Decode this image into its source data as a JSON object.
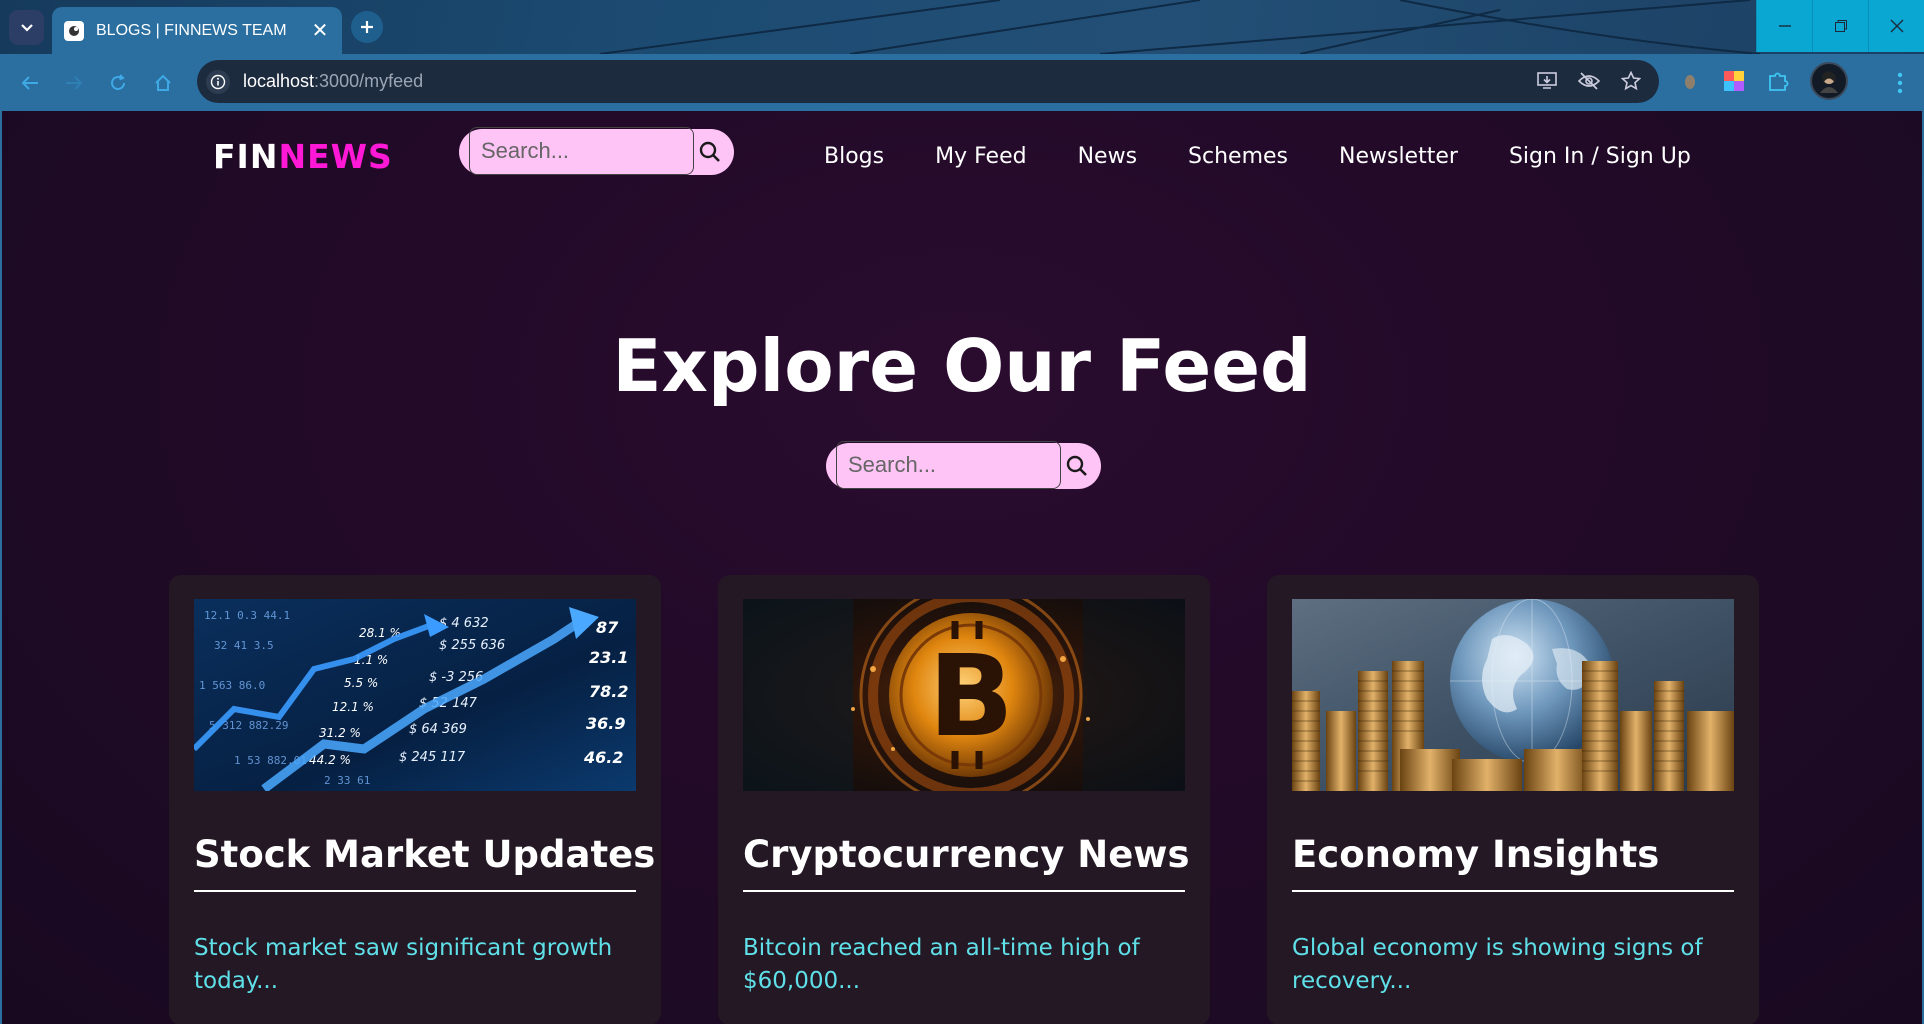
{
  "browser": {
    "tab_title": "BLOGS | FINNEWS TEAM",
    "url_host": "localhost",
    "url_path": ":3000/myfeed"
  },
  "site": {
    "logo_part1": "FIN",
    "logo_part2": "NEWS",
    "header_search_placeholder": "Search...",
    "nav": [
      "Blogs",
      "My Feed",
      "News",
      "Schemes",
      "Newsletter",
      "Sign In / Sign Up"
    ]
  },
  "hero": {
    "title": "Explore Our Feed",
    "search_placeholder": "Search..."
  },
  "cards": [
    {
      "title": "Stock Market Updates",
      "text": "Stock market saw significant growth today...",
      "image": "stock-chart-image"
    },
    {
      "title": "Cryptocurrency News",
      "text": "Bitcoin reached an all-time high of $60,000...",
      "image": "bitcoin-coin-image"
    },
    {
      "title": "Economy Insights",
      "text": "Global economy is showing signs of recovery...",
      "image": "globe-coins-image"
    }
  ],
  "colors": {
    "logo_accent": "#ff19d6",
    "search_bg": "#ffc4f6",
    "card_text": "#5fe0e8",
    "page_bg": "#1a0b1d"
  }
}
